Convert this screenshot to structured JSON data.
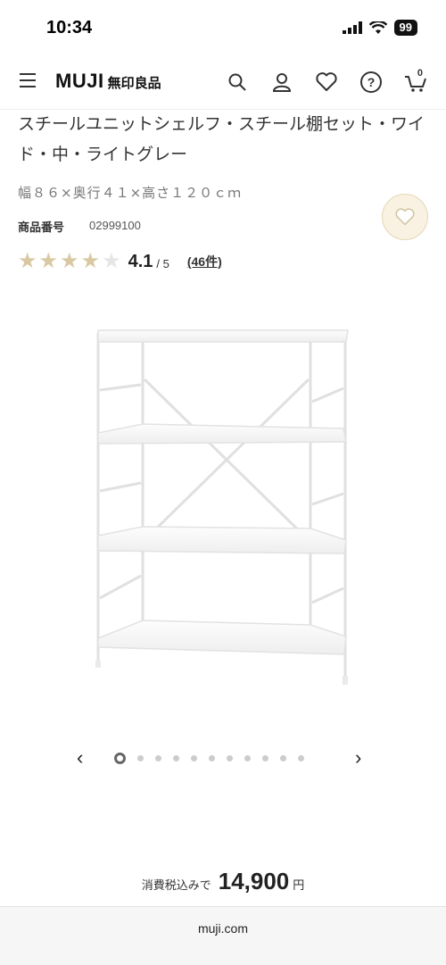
{
  "status_bar": {
    "time": "10:34",
    "battery": "99"
  },
  "header": {
    "logo": "MUJI",
    "logo_jp": "無印良品",
    "cart_count": "0"
  },
  "product": {
    "title": "スチールユニットシェルフ・スチール棚セット・ワイド・中・ライトグレー",
    "size": "幅８６×奥行４１×高さ１２０ｃｍ",
    "product_number_label": "商品番号",
    "product_number": "02999100",
    "rating": {
      "score": "4.1",
      "out_of": "/ 5",
      "reviews": "(46件)",
      "stars_value": 4.1,
      "stars_max": 5
    }
  },
  "carousel": {
    "total": 11,
    "current": 1
  },
  "price": {
    "label": "消費税込みで",
    "amount": "14,900",
    "unit": "円"
  },
  "browser": {
    "url": "muji.com"
  },
  "colors": {
    "star_filled": "#d9c9a3",
    "star_empty": "#e6e6e6",
    "fav_bg": "#f9f2e2"
  }
}
